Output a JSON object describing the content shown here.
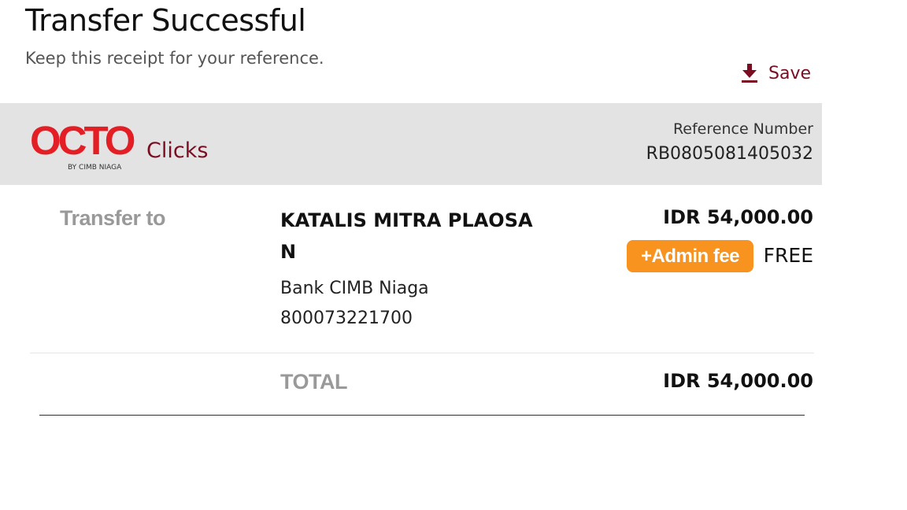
{
  "page": {
    "title": "Transfer Successful",
    "subtitle": "Keep this receipt for your reference."
  },
  "actions": {
    "save_label": "Save",
    "save_icon": "download-icon"
  },
  "header": {
    "logo_text": "OCTO",
    "logo_suffix": "Clicks",
    "logo_by": "BY CIMB NIAGA",
    "reference_label": "Reference Number",
    "reference_number": "RB0805081405032"
  },
  "transfer": {
    "label": "Transfer to",
    "recipient_name": "KATALIS MITRA PLAOSAN",
    "bank_name": "Bank CIMB Niaga",
    "account_number": "800073221700",
    "amount": "IDR 54,000.00",
    "admin_fee_label": "+Admin fee",
    "admin_fee_value": "FREE"
  },
  "total": {
    "label": "TOTAL",
    "amount": "IDR 54,000.00"
  },
  "colors": {
    "brand_red": "#e31e24",
    "brand_maroon": "#7a0d22",
    "badge_orange": "#f7931e",
    "header_gray": "#e3e3e3"
  }
}
